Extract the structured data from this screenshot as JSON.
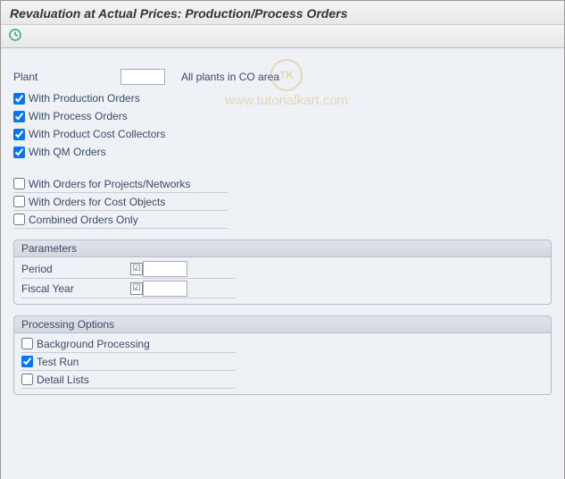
{
  "header": {
    "title": "Revaluation at Actual Prices: Production/Process Orders"
  },
  "watermark": {
    "logo_text": "TK",
    "text": "www.tutorialkart.com"
  },
  "plant": {
    "label": "Plant",
    "value": "",
    "hint": "All plants in CO area"
  },
  "selection_checks": {
    "production": {
      "label": "With Production Orders",
      "checked": true
    },
    "process": {
      "label": "With Process Orders",
      "checked": true
    },
    "cost_collectors": {
      "label": "With Product Cost Collectors",
      "checked": true
    },
    "qm": {
      "label": "With QM Orders",
      "checked": true
    }
  },
  "order_checks": {
    "projects": {
      "label": "With Orders for Projects/Networks",
      "checked": false
    },
    "cost_objects": {
      "label": "With Orders for Cost Objects",
      "checked": false
    },
    "combined": {
      "label": "Combined Orders Only",
      "checked": false
    }
  },
  "parameters": {
    "title": "Parameters",
    "period": {
      "label": "Period",
      "value": ""
    },
    "fiscal_year": {
      "label": "Fiscal Year",
      "value": ""
    }
  },
  "processing": {
    "title": "Processing Options",
    "background": {
      "label": "Background Processing",
      "checked": false
    },
    "test_run": {
      "label": "Test Run",
      "checked": true
    },
    "detail_lists": {
      "label": "Detail Lists",
      "checked": false
    }
  }
}
